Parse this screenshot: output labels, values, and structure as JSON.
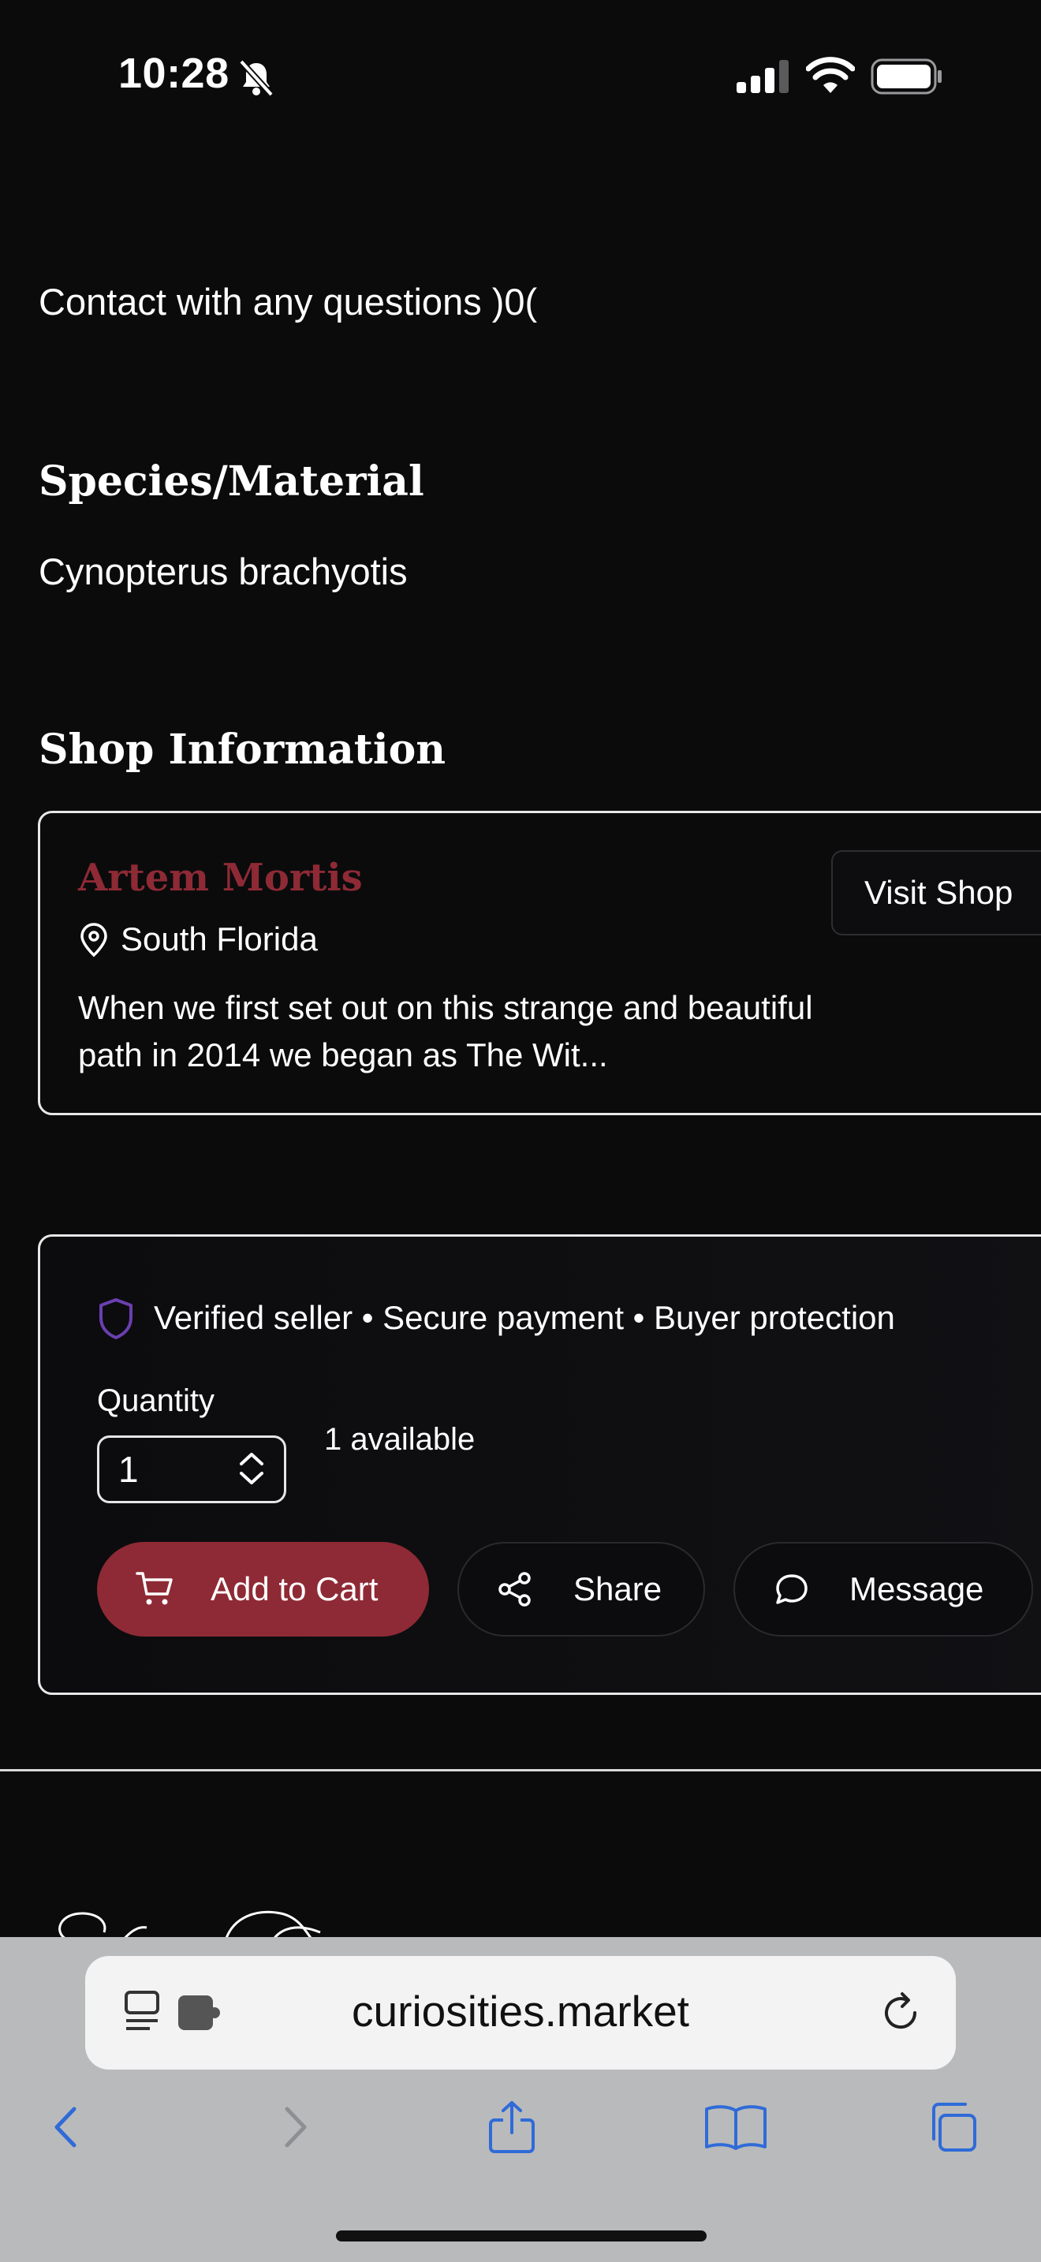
{
  "status_bar": {
    "time": "10:28"
  },
  "content": {
    "contact_text": "Contact with any questions )0(",
    "species_heading": "Species/Material",
    "species_value": "Cynopterus brachyotis",
    "shop_heading": "Shop Information"
  },
  "shop": {
    "name": "Artem Mortis",
    "location": "South Florida",
    "description": "When we first set out on this strange and beautiful path in 2014 we began as The Wit...",
    "visit_label": "Visit Shop"
  },
  "purchase": {
    "trust_line": "Verified seller • Secure payment • Buyer protection",
    "quantity_label": "Quantity",
    "quantity_value": "1",
    "available_text": "1 available",
    "add_to_cart_label": "Add to Cart",
    "share_label": "Share",
    "message_label": "Message"
  },
  "browser": {
    "url": "curiosities.market"
  },
  "colors": {
    "background": "#0b0b0c",
    "accent": "#8e2a35",
    "shield": "#6b3fb0",
    "toolbar_blue": "#2f6bd8"
  }
}
